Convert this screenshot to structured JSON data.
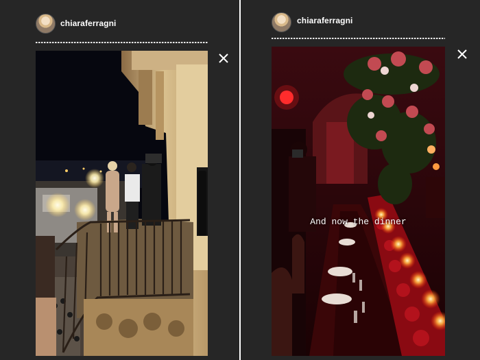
{
  "stories": [
    {
      "username": "chiaraferragni",
      "avatar_icon": "profile-avatar",
      "close_icon": "close-icon",
      "scene": "balcony at night overlooking a lit square"
    },
    {
      "username": "chiaraferragni",
      "avatar_icon": "profile-avatar",
      "close_icon": "close-icon",
      "caption": "And now the dinner",
      "scene": "candlelit dinner table with red roses"
    }
  ],
  "colors": {
    "panel_bg": "#262626",
    "progress": "#eaeaea",
    "text": "#ffffff"
  }
}
